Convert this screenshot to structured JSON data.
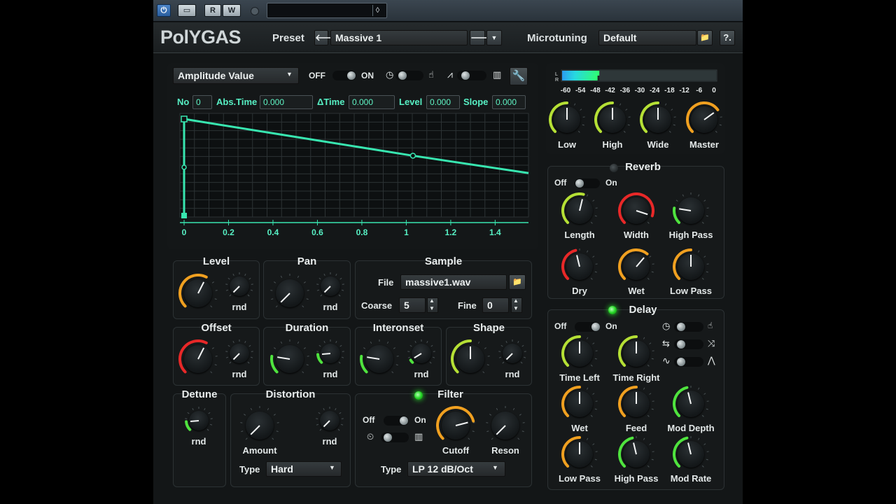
{
  "host": {
    "power": "⏻",
    "box": "▭",
    "read": "R",
    "write": "W",
    "field_arrow": "◊"
  },
  "header": {
    "logo": "PolYGAS",
    "preset_label": "Preset",
    "preset_value": "Massive 1",
    "prev": "🡐",
    "next": "🡒",
    "dropdown": "▼",
    "microtuning_label": "Microtuning",
    "microtuning_value": "Default",
    "folder": "📁",
    "help": "?."
  },
  "envelope": {
    "mode_value": "Amplitude Value",
    "off": "OFF",
    "on": "ON",
    "fields": {
      "no_label": "No",
      "no_value": "0",
      "abs_time_label": "Abs.Time",
      "abs_time_value": "0.000",
      "delta_time_label": "ΔTime",
      "delta_time_value": "0.000",
      "level_label": "Level",
      "level_value": "0.000",
      "slope_label": "Slope",
      "slope_value": "0.000"
    },
    "x_ticks": [
      "0",
      "0.2",
      "0.4",
      "0.6",
      "0.8",
      "1",
      "1.2",
      "1.4"
    ],
    "points": [
      {
        "t": 0,
        "v": 1.0
      },
      {
        "t": 1.03,
        "v": 0.62
      },
      {
        "t": 1.55,
        "v": 0.44
      }
    ],
    "line_color": "#38e6b0"
  },
  "meter": {
    "ticks": [
      "-60",
      "-54",
      "-48",
      "-42",
      "-36",
      "-30",
      "-24",
      "-18",
      "-12",
      "-6",
      "0"
    ],
    "channels": [
      "L",
      "R"
    ],
    "fill_fraction": 0.24
  },
  "master": {
    "low_label": "Low",
    "high_label": "High",
    "wide_label": "Wide",
    "master_label": "Master"
  },
  "reverb": {
    "title": "Reverb",
    "off": "Off",
    "on": "On",
    "length": "Length",
    "width": "Width",
    "high_pass": "High Pass",
    "dry": "Dry",
    "wet": "Wet",
    "low_pass": "Low Pass"
  },
  "delay": {
    "title": "Delay",
    "off": "Off",
    "on": "On",
    "time_left": "Time Left",
    "time_right": "Time Right",
    "wet": "Wet",
    "feed": "Feed",
    "mod_depth": "Mod Depth",
    "low_pass": "Low Pass",
    "high_pass": "High Pass",
    "mod_rate": "Mod Rate"
  },
  "sections": {
    "level": "Level",
    "pan": "Pan",
    "sample": "Sample",
    "offset": "Offset",
    "duration": "Duration",
    "interonset": "Interonset",
    "shape": "Shape",
    "detune": "Detune",
    "distortion": "Distortion",
    "filter": "Filter",
    "rnd": "rnd"
  },
  "sample": {
    "file_label": "File",
    "file_value": "massive1.wav",
    "coarse_label": "Coarse",
    "coarse_value": "5",
    "fine_label": "Fine",
    "fine_value": "0"
  },
  "distortion": {
    "amount": "Amount",
    "type_label": "Type",
    "type_value": "Hard"
  },
  "filter": {
    "off": "Off",
    "on": "On",
    "cutoff": "Cutoff",
    "reson": "Reson",
    "type_label": "Type",
    "type_value": "LP 12 dB/Oct"
  },
  "colors": {
    "green": "#4fe33e",
    "yellow_green": "#b5e035",
    "orange": "#f0a020",
    "red": "#e82828",
    "teal": "#57f0c4"
  }
}
